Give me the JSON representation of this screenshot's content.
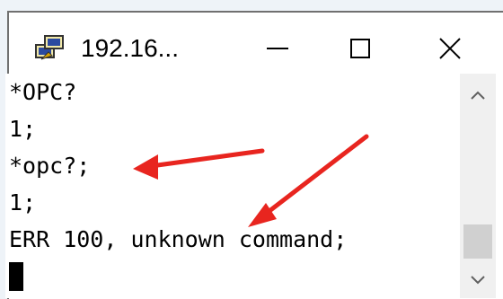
{
  "window": {
    "title": "192.16...",
    "minimize_icon": "minimize-icon",
    "maximize_icon": "maximize-icon",
    "close_icon": "close-icon",
    "app_icon": "putty-icon"
  },
  "terminal": {
    "lines": [
      "*OPC?",
      "1;",
      "*opc?;",
      "1;",
      "ERR 100, unknown command;"
    ]
  },
  "scrollbar": {
    "up_icon": "chevron-up-icon",
    "down_icon": "chevron-down-icon"
  },
  "annotations": {
    "arrow_color": "#e8251f"
  }
}
